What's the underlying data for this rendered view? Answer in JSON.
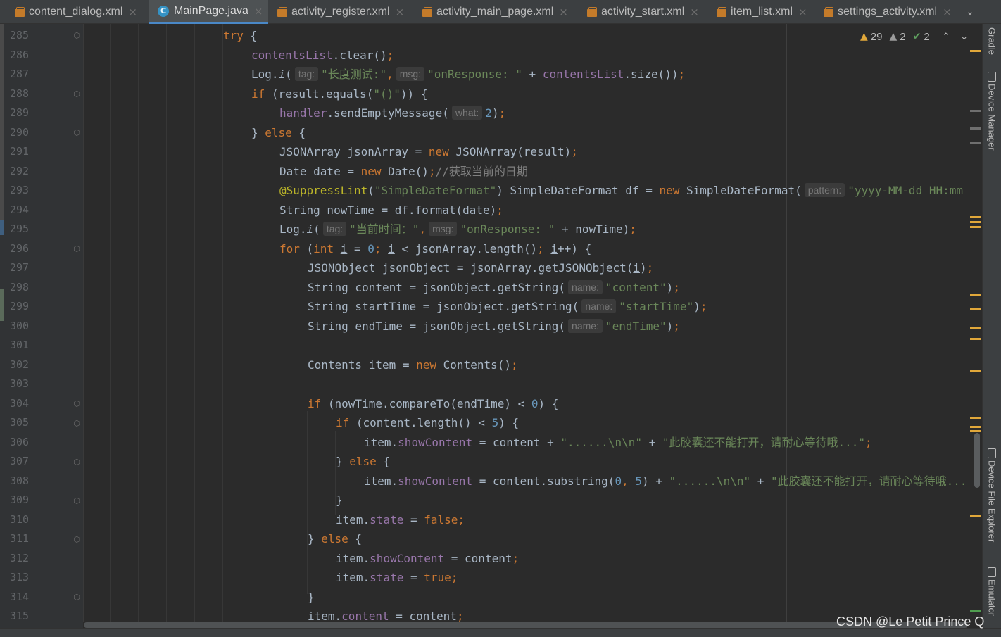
{
  "tabs": [
    {
      "label": "content_dialog.xml",
      "icon": "xml-file-icon",
      "active": false
    },
    {
      "label": "MainPage.java",
      "icon": "java-class-icon",
      "active": true
    },
    {
      "label": "activity_register.xml",
      "icon": "xml-file-icon",
      "active": false
    },
    {
      "label": "activity_main_page.xml",
      "icon": "xml-file-icon",
      "active": false
    },
    {
      "label": "activity_start.xml",
      "icon": "xml-file-icon",
      "active": false
    },
    {
      "label": "item_list.xml",
      "icon": "xml-file-icon",
      "active": false
    },
    {
      "label": "settings_activity.xml",
      "icon": "xml-file-icon",
      "active": false
    }
  ],
  "inspections": {
    "warnings": "29",
    "weak_warnings": "2",
    "typos": "2"
  },
  "line_numbers": [
    "285",
    "286",
    "287",
    "288",
    "289",
    "290",
    "291",
    "292",
    "293",
    "294",
    "295",
    "296",
    "297",
    "298",
    "299",
    "300",
    "301",
    "302",
    "303",
    "304",
    "305",
    "306",
    "307",
    "308",
    "309",
    "310",
    "311",
    "312",
    "313",
    "314",
    "315"
  ],
  "code": {
    "l285": {
      "kw": "try",
      "rest": " {"
    },
    "l286": {
      "fld": "contentsList",
      "rest": ".clear()",
      "semi": ";"
    },
    "l287": {
      "pre": "Log.",
      "mth": "i",
      "open": "(",
      "hint1": "tag:",
      "str1": "\"长度测试:\"",
      "comma1": ",",
      "hint2": "msg:",
      "str2": "\"onResponse: \"",
      "plus": " + ",
      "fld": "contentsList",
      "rest": ".size())",
      "semi": ";"
    },
    "l288": {
      "kw": "if",
      "rest1": " (result.equals(",
      "str": "\"()\"",
      "rest2": ")) {"
    },
    "l289": {
      "fld": "handler",
      "rest": ".sendEmptyMessage(",
      "hint": "what:",
      "num": "2",
      "close": ")",
      "semi": ";"
    },
    "l290": {
      "pre": "} ",
      "kw": "else",
      "rest": " {"
    },
    "l291": {
      "pre": "JSONArray jsonArray = ",
      "kw": "new",
      "rest": " JSONArray(result)",
      "semi": ";"
    },
    "l292": {
      "pre": "Date date = ",
      "kw": "new",
      "rest": " Date()",
      "semi": ";",
      "cmt": "//获取当前的日期"
    },
    "l293": {
      "ann": "@SuppressLint",
      "open": "(",
      "str": "\"SimpleDateFormat\"",
      "mid": ") SimpleDateFormat df = ",
      "kw": "new",
      "rest": " SimpleDateFormat(",
      "hint": "pattern:",
      "str2": "\"yyyy-MM-dd HH:mm"
    },
    "l294": {
      "pre": "String nowTime = df.format(date)",
      "semi": ";"
    },
    "l295": {
      "pre": "Log.",
      "mth": "i",
      "open": "(",
      "hint1": "tag:",
      "str1": "\"当前时间：\"",
      "comma1": ",",
      "hint2": "msg:",
      "str2": "\"onResponse: \"",
      "rest": " + nowTime)",
      "semi": ";"
    },
    "l296": {
      "kw1": "for",
      "open": " (",
      "kw2": "int",
      "sp": " ",
      "var1": "i",
      "eq": " = ",
      "num": "0",
      "semi1": ";",
      "sp2": " ",
      "var2": "i",
      "mid": " < jsonArray.length()",
      "semi2": ";",
      "sp3": " ",
      "var3": "i",
      "rest": "++) {"
    },
    "l297": {
      "pre": "JSONObject jsonObject = jsonArray.getJSONObject(",
      "var": "i",
      "close": ")",
      "semi": ";"
    },
    "l298": {
      "pre": "String content = jsonObject.getString(",
      "hint": "name:",
      "str": "\"content\"",
      "close": ")",
      "semi": ";"
    },
    "l299": {
      "pre": "String startTime = jsonObject.getString(",
      "hint": "name:",
      "str": "\"startTime\"",
      "close": ")",
      "semi": ";"
    },
    "l300": {
      "pre": "String endTime = jsonObject.getString(",
      "hint": "name:",
      "str": "\"endTime\"",
      "close": ")",
      "semi": ";"
    },
    "l302": {
      "pre": "Contents item = ",
      "kw": "new",
      "rest": " Contents()",
      "semi": ";"
    },
    "l304": {
      "kw": "if",
      "rest1": " (nowTime.compareTo(endTime) < ",
      "num": "0",
      "rest2": ") {"
    },
    "l305": {
      "kw": "if",
      "rest1": " (content.length() < ",
      "num": "5",
      "rest2": ") {"
    },
    "l306": {
      "pre": "item.",
      "fld": "showContent",
      "mid": " = content + ",
      "str1": "\"......\\n\\n\"",
      "plus": " + ",
      "str2": "\"此胶囊还不能打开，请耐心等待哦...\"",
      "semi": ";"
    },
    "l307": {
      "pre": "} ",
      "kw": "else",
      "rest": " {"
    },
    "l308": {
      "pre": "item.",
      "fld": "showContent",
      "mid": " = content.substring(",
      "num1": "0",
      "comma": ",",
      "sp": " ",
      "num2": "5",
      "close": ") + ",
      "str1": "\"......\\n\\n\"",
      "plus": " + ",
      "str2": "\"此胶囊还不能打开，请耐心等待哦..."
    },
    "l309": {
      "text": "}"
    },
    "l310": {
      "pre": "item.",
      "fld": "state",
      "mid": " = ",
      "kw": "false",
      "semi": ";"
    },
    "l311": {
      "pre": "} ",
      "kw": "else",
      "rest": " {"
    },
    "l312": {
      "pre": "item.",
      "fld": "showContent",
      "mid": " = content",
      "semi": ";"
    },
    "l313": {
      "pre": "item.",
      "fld": "state",
      "mid": " = ",
      "kw": "true",
      "semi": ";"
    },
    "l314": {
      "text": "}"
    },
    "l315": {
      "pre": "item.",
      "fld": "content",
      "mid": " = content",
      "semi": ";"
    }
  },
  "side_tools": {
    "gradle": "Gradle",
    "device_manager": "Device Manager",
    "device_file_explorer": "Device File Explorer",
    "emulator": "Emulator"
  },
  "watermark": "CSDN @Le Petit Prince Q",
  "colors": {
    "keyword": "#cc7832",
    "field": "#9876aa",
    "string": "#6a8759",
    "number": "#6897bb",
    "annotation": "#bbb529",
    "text": "#a9b7c6",
    "background": "#2b2b2b"
  }
}
